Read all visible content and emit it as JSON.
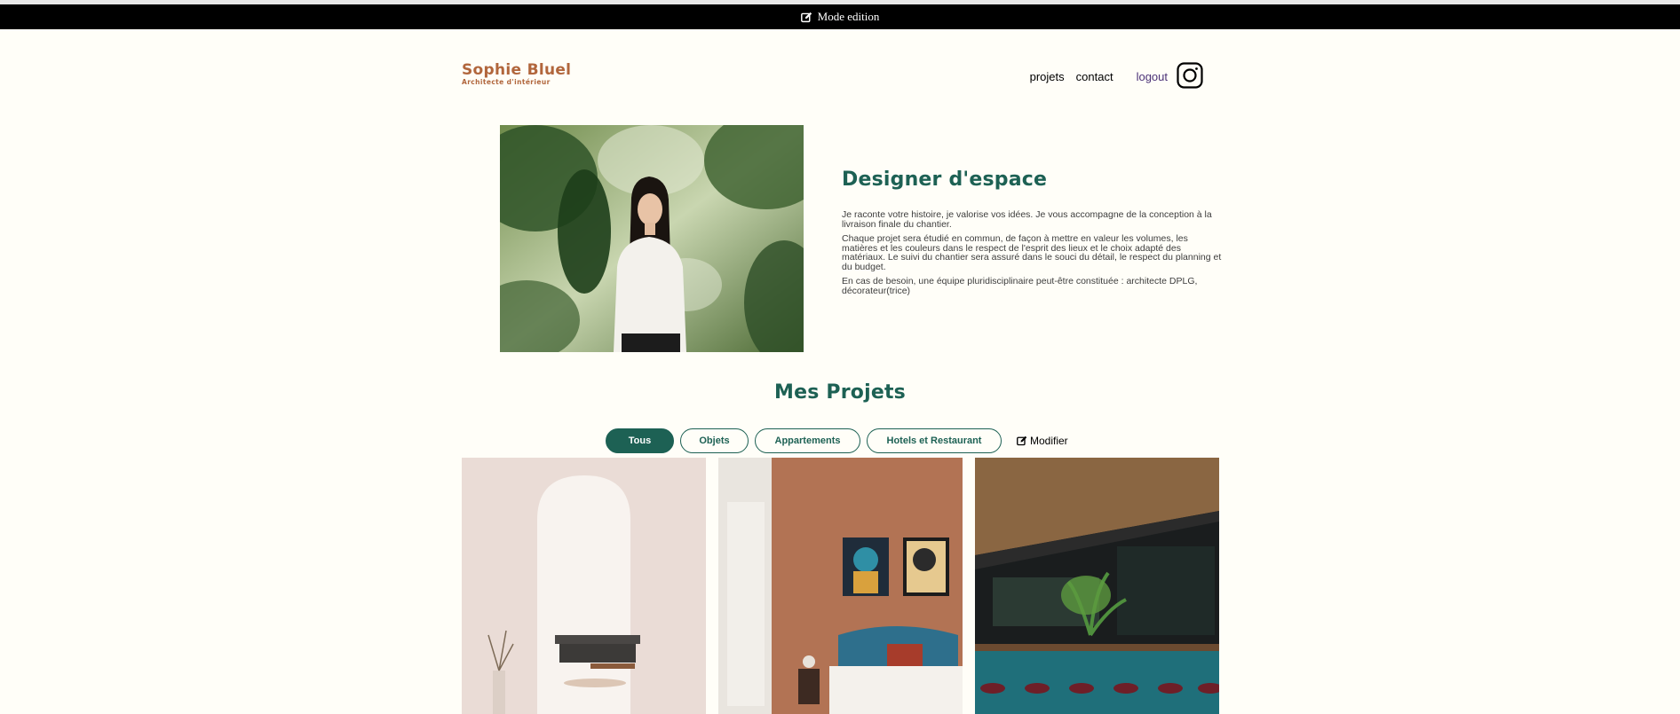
{
  "edit_bar": {
    "label": "Mode edition",
    "icon": "pen-to-square-icon"
  },
  "brand": {
    "name": "Sophie Bluel",
    "subtitle": "Architecte d'intérieur"
  },
  "nav": {
    "items": [
      "projets",
      "contact"
    ],
    "logout": "logout",
    "social_icon": "instagram-icon"
  },
  "intro": {
    "title": "Designer d'espace",
    "paragraphs": [
      "Je raconte votre histoire, je valorise vos idées. Je vous accompagne de la conception à la livraison finale du chantier.",
      "Chaque projet sera étudié en commun, de façon à mettre en valeur les volumes, les matières et les couleurs dans le respect de l'esprit des lieux et le choix adapté des matériaux. Le suivi du chantier sera assuré dans le souci du détail, le respect du planning et du budget.",
      "En cas de besoin, une équipe pluridisciplinaire peut-être constituée : architecte DPLG, décorateur(trice)"
    ]
  },
  "projects": {
    "title": "Mes Projets",
    "filters": [
      "Tous",
      "Objets",
      "Appartements",
      "Hotels et Restaurant"
    ],
    "active_filter": "Tous",
    "modify_label": "Modifier"
  },
  "colors": {
    "accent": "#1d6154",
    "brand": "#b1663c",
    "background": "#fffef8",
    "logout": "#4b3277"
  }
}
